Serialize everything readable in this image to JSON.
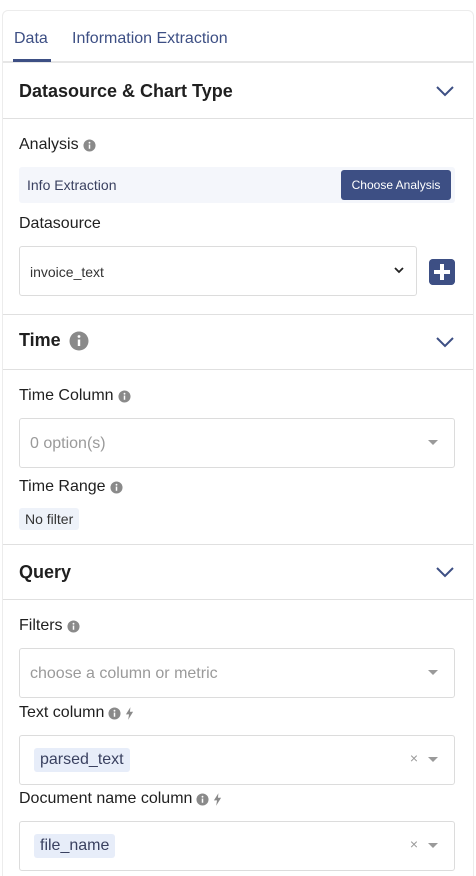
{
  "tabs": [
    "Data",
    "Information Extraction"
  ],
  "sections": {
    "datasource": {
      "title": "Datasource & Chart Type"
    },
    "time": {
      "title": "Time"
    },
    "query": {
      "title": "Query"
    }
  },
  "analysis": {
    "label": "Analysis",
    "value": "Info Extraction",
    "button": "Choose Analysis"
  },
  "datasource": {
    "label": "Datasource",
    "value": "invoice_text"
  },
  "time_column": {
    "label": "Time Column",
    "placeholder": "0 option(s)"
  },
  "time_range": {
    "label": "Time Range",
    "value": "No filter"
  },
  "filters": {
    "label": "Filters",
    "placeholder": "choose a column or metric"
  },
  "text_column": {
    "label": "Text column",
    "value": "parsed_text"
  },
  "doc_name_column": {
    "label": "Document name column",
    "value": "file_name"
  },
  "icons": {
    "info": "info-icon",
    "lightning": "lightning-icon",
    "chevron": "chevron-down-icon",
    "plus": "plus-icon"
  },
  "colors": {
    "accent": "#3d4f84",
    "tag_bg": "#e7edf9",
    "analysis_bg": "#f4f6fb"
  }
}
